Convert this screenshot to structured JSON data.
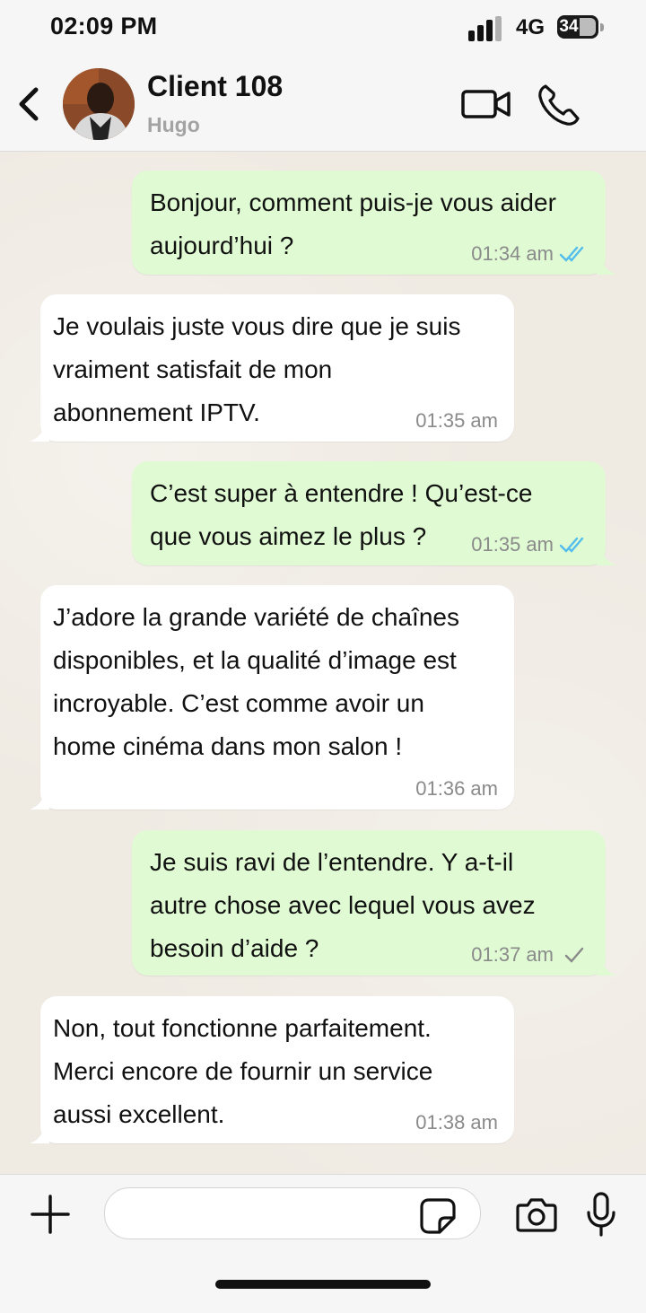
{
  "status_bar": {
    "time": "02:09 PM",
    "network": "4G",
    "battery": "34"
  },
  "header": {
    "contact_name": "Client 108",
    "contact_subtitle": "Hugo"
  },
  "messages": [
    {
      "direction": "out",
      "text": "Bonjour, comment puis-je vous aider\naujourd’hui ?",
      "time": "01:34 am",
      "status": "read"
    },
    {
      "direction": "in",
      "text": "Je voulais juste vous dire que je suis\nvraiment satisfait de mon\nabonnement IPTV.",
      "time": "01:35 am"
    },
    {
      "direction": "out",
      "text": "C’est super à entendre ! Qu’est-ce\nque vous aimez le plus ?",
      "time": "01:35 am",
      "status": "read"
    },
    {
      "direction": "in",
      "text": "J’adore la grande variété de chaînes\ndisponibles, et la qualité d’image est\nincroyable. C’est comme avoir un\nhome cinéma dans mon salon !",
      "time": "01:36 am"
    },
    {
      "direction": "out",
      "text": "Je suis ravi de l’entendre. Y a-t-il\nautre chose avec lequel vous avez\nbesoin d’aide ?",
      "time": "01:37 am",
      "status": "sent"
    },
    {
      "direction": "in",
      "text": "Non, tout fonctionne parfaitement.\nMerci encore de fournir un service\naussi excellent.",
      "time": "01:38 am"
    }
  ],
  "input": {
    "placeholder": ""
  },
  "colors": {
    "outgoing_bubble": "#e0fbd3",
    "incoming_bubble": "#ffffff",
    "read_tick": "#53bdeb",
    "sent_tick": "#8a8a8a"
  }
}
